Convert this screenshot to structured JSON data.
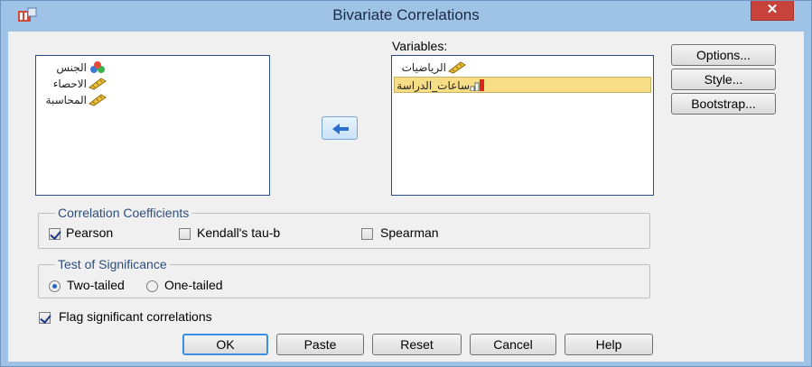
{
  "window": {
    "title": "Bivariate Correlations",
    "close_label": "✕"
  },
  "source_list": {
    "items": [
      {
        "label": "الجنس",
        "icon": "nominal-icon"
      },
      {
        "label": "الاحصاء",
        "icon": "scale-ruler-icon"
      },
      {
        "label": "المحاسبة",
        "icon": "scale-ruler-icon"
      }
    ]
  },
  "variables": {
    "label": "Variables:",
    "items": [
      {
        "label": "الرياضيات",
        "icon": "scale-ruler-icon",
        "selected": false
      },
      {
        "label": "ساعات_الدراسة",
        "icon": "ordinal-icon",
        "selected": true
      }
    ]
  },
  "side_buttons": {
    "options": "Options...",
    "style": "Style...",
    "bootstrap": "Bootstrap..."
  },
  "correlation": {
    "legend": "Correlation Coefficients",
    "pearson": {
      "label": "Pearson",
      "checked": true
    },
    "kendall": {
      "label": "Kendall's tau-b",
      "checked": false
    },
    "spearman": {
      "label": "Spearman",
      "checked": false
    }
  },
  "significance": {
    "legend": "Test of Significance",
    "two_tailed": {
      "label": "Two-tailed",
      "checked": true
    },
    "one_tailed": {
      "label": "One-tailed",
      "checked": false
    }
  },
  "flag": {
    "label": "Flag significant correlations",
    "checked": true
  },
  "bottom_buttons": {
    "ok": "OK",
    "paste": "Paste",
    "reset": "Reset",
    "cancel": "Cancel",
    "help": "Help"
  },
  "colors": {
    "titlebar": "#9fc3e7",
    "selection": "#f7dd86",
    "close": "#c7423a"
  }
}
